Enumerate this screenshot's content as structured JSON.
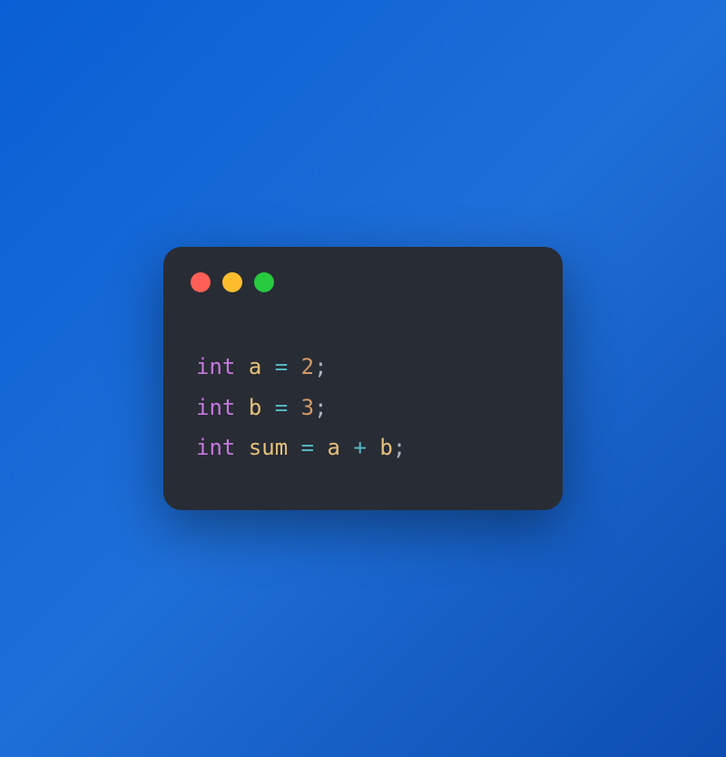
{
  "colors": {
    "close": "#ff5f56",
    "minimize": "#ffbd2e",
    "zoom": "#27c93f"
  },
  "code": {
    "lines": [
      {
        "tokens": [
          {
            "cls": "kw",
            "text": "int"
          },
          {
            "cls": "",
            "text": " "
          },
          {
            "cls": "var",
            "text": "a"
          },
          {
            "cls": "",
            "text": " "
          },
          {
            "cls": "op",
            "text": "="
          },
          {
            "cls": "",
            "text": " "
          },
          {
            "cls": "num",
            "text": "2"
          },
          {
            "cls": "semi",
            "text": ";"
          }
        ]
      },
      {
        "tokens": [
          {
            "cls": "kw",
            "text": "int"
          },
          {
            "cls": "",
            "text": " "
          },
          {
            "cls": "var",
            "text": "b"
          },
          {
            "cls": "",
            "text": " "
          },
          {
            "cls": "op",
            "text": "="
          },
          {
            "cls": "",
            "text": " "
          },
          {
            "cls": "num",
            "text": "3"
          },
          {
            "cls": "semi",
            "text": ";"
          }
        ]
      },
      {
        "tokens": [
          {
            "cls": "kw",
            "text": "int"
          },
          {
            "cls": "",
            "text": " "
          },
          {
            "cls": "var",
            "text": "sum"
          },
          {
            "cls": "",
            "text": " "
          },
          {
            "cls": "op",
            "text": "="
          },
          {
            "cls": "",
            "text": " "
          },
          {
            "cls": "var",
            "text": "a"
          },
          {
            "cls": "",
            "text": " "
          },
          {
            "cls": "op",
            "text": "+"
          },
          {
            "cls": "",
            "text": " "
          },
          {
            "cls": "var",
            "text": "b"
          },
          {
            "cls": "semi",
            "text": ";"
          }
        ]
      }
    ]
  }
}
